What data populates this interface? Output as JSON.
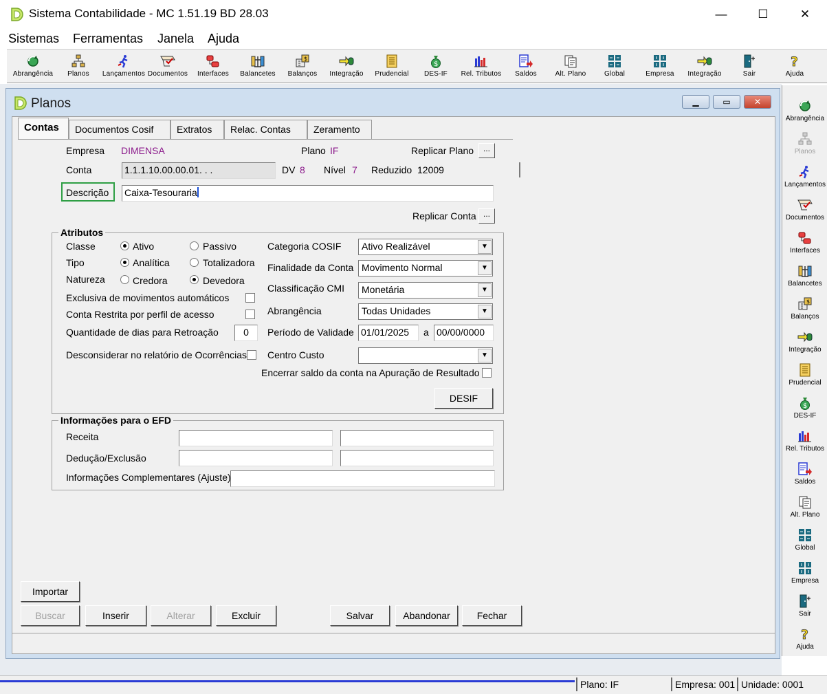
{
  "window": {
    "title": "Sistema Contabilidade -  MC 1.51.19 BD 28.03",
    "minimize": "—",
    "maximize": "☐",
    "close": "✕"
  },
  "menu": [
    "Sistemas",
    "Ferramentas",
    "Janela",
    "Ajuda"
  ],
  "toolbar": [
    {
      "label": "Abrangência",
      "icon": "refresh-globe-icon"
    },
    {
      "label": "Planos",
      "icon": "hierarchy-icon"
    },
    {
      "label": "Lançamentos",
      "icon": "runner-icon"
    },
    {
      "label": "Documentos",
      "icon": "document-check-icon"
    },
    {
      "label": "Interfaces",
      "icon": "interfaces-icon"
    },
    {
      "label": "Balancetes",
      "icon": "scale-icon"
    },
    {
      "label": "Balanços",
      "icon": "building-icon"
    },
    {
      "label": "Integração",
      "icon": "arrow-integration-icon"
    },
    {
      "label": "Prudencial",
      "icon": "ledger-icon"
    },
    {
      "label": "DES-IF",
      "icon": "money-bag-icon"
    },
    {
      "label": "Rel. Tributos",
      "icon": "bar-chart-icon"
    },
    {
      "label": "Saldos",
      "icon": "report-arrow-icon"
    },
    {
      "label": "Alt. Plano",
      "icon": "document-copy-icon"
    },
    {
      "label": "Global",
      "icon": "grid-global-icon"
    },
    {
      "label": "Empresa",
      "icon": "grid-company-icon"
    },
    {
      "label": "Integração",
      "icon": "arrow-integration-icon"
    },
    {
      "label": "Sair",
      "icon": "exit-door-icon"
    },
    {
      "label": "Ajuda",
      "icon": "question-icon"
    }
  ],
  "right_toolbar": [
    {
      "label": "Abrangência"
    },
    {
      "label": "Planos"
    },
    {
      "label": "Lançamentos"
    },
    {
      "label": "Documentos"
    },
    {
      "label": "Interfaces"
    },
    {
      "label": "Balancetes"
    },
    {
      "label": "Balanços"
    },
    {
      "label": "Integração"
    },
    {
      "label": "Prudencial"
    },
    {
      "label": "DES-IF"
    },
    {
      "label": "Rel. Tributos"
    },
    {
      "label": "Saldos"
    },
    {
      "label": "Alt. Plano"
    },
    {
      "label": "Global"
    },
    {
      "label": "Empresa"
    },
    {
      "label": "Sair"
    },
    {
      "label": "Ajuda"
    }
  ],
  "planos": {
    "title": "Planos",
    "tabs": [
      "Contas",
      "Documentos Cosif",
      "Extratos",
      "Relac. Contas",
      "Zeramento"
    ],
    "active_tab": "Contas",
    "empresa_label": "Empresa",
    "empresa_value": "DIMENSA",
    "plano_label": "Plano",
    "plano_value": "IF",
    "replicar_plano_label": "Replicar Plano",
    "conta_label": "Conta",
    "conta_value": "1.1.1.10.00.00.01.  .    .",
    "dv_label": "DV",
    "dv_value": "8",
    "nivel_label": "Nível",
    "nivel_value": "7",
    "reduzido_label": "Reduzido",
    "reduzido_value": "12009",
    "descricao_label": "Descrição",
    "descricao_value": "Caixa-Tesouraria",
    "replicar_conta_label": "Replicar Conta",
    "ellipsis": "...",
    "atributos": {
      "title": "Atributos",
      "classe_label": "Classe",
      "classe_ativo": "Ativo",
      "classe_passivo": "Passivo",
      "tipo_label": "Tipo",
      "tipo_analitica": "Analítica",
      "tipo_totalizadora": "Totalizadora",
      "natureza_label": "Natureza",
      "natureza_credora": "Credora",
      "natureza_devedora": "Devedora",
      "exclusiva_label": "Exclusiva de movimentos automáticos",
      "restrita_label": "Conta Restrita por perfil de acesso",
      "retroacao_label": "Quantidade de dias para Retroação",
      "retroacao_value": "0",
      "desconsiderar_label": "Desconsiderar no relatório de Ocorrências",
      "categoria_label": "Categoria COSIF",
      "categoria_value": "Ativo Realizável",
      "finalidade_label": "Finalidade da Conta",
      "finalidade_value": "Movimento Normal",
      "classificacao_label": "Classificação CMI",
      "classificacao_value": "Monetária",
      "abrangencia_label": "Abrangência",
      "abrangencia_value": "Todas Unidades",
      "periodo_label": "Período de Validade",
      "periodo_inicio": "01/01/2025",
      "periodo_a": "a",
      "periodo_fim": "00/00/0000",
      "centro_custo_label": "Centro Custo",
      "centro_custo_value": "",
      "encerrar_label": "Encerrar saldo da conta na Apuração de Resultado",
      "desif_button": "DESIF"
    },
    "efd": {
      "title": "Informações para o EFD",
      "receita_label": "Receita",
      "deducao_label": "Dedução/Exclusão",
      "complementares_label": "Informações Complementares (Ajuste)"
    },
    "buttons": {
      "importar": "Importar",
      "buscar": "Buscar",
      "inserir": "Inserir",
      "alterar": "Alterar",
      "excluir": "Excluir",
      "salvar": "Salvar",
      "abandonar": "Abandonar",
      "fechar": "Fechar"
    }
  },
  "statusbar": {
    "plano": "Plano:     IF",
    "empresa": "Empresa: 001",
    "unidade": "Unidade: 0001"
  },
  "colors": {
    "accent_purple": "#8b1a8b",
    "highlight_green": "#2e9e44",
    "mdi_title_bg": "#cfdff0"
  }
}
